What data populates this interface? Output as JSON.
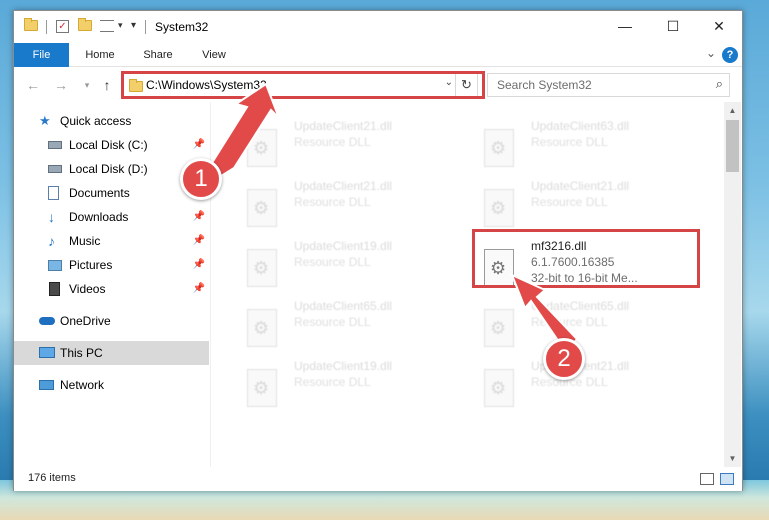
{
  "window": {
    "title": "System32",
    "controls": {
      "minimize": "—",
      "maximize": "☐",
      "close": "✕"
    }
  },
  "ribbon": {
    "tabs": [
      "File",
      "Home",
      "Share",
      "View"
    ],
    "help": "?"
  },
  "nav": {
    "address": "C:\\Windows\\System32",
    "search_placeholder": "Search System32"
  },
  "sidebar": {
    "items": [
      {
        "label": "Quick access",
        "icon": "star-icon"
      },
      {
        "label": "Local Disk (C:)",
        "icon": "drive-icon",
        "pinned": true
      },
      {
        "label": "Local Disk (D:)",
        "icon": "drive-icon"
      },
      {
        "label": "Documents",
        "icon": "documents-icon"
      },
      {
        "label": "Downloads",
        "icon": "downloads-icon",
        "pinned": true
      },
      {
        "label": "Music",
        "icon": "music-icon",
        "pinned": true
      },
      {
        "label": "Pictures",
        "icon": "pictures-icon",
        "pinned": true
      },
      {
        "label": "Videos",
        "icon": "videos-icon",
        "pinned": true
      },
      {
        "label": "OneDrive",
        "icon": "cloud-icon"
      },
      {
        "label": "This PC",
        "icon": "pc-icon",
        "selected": true
      },
      {
        "label": "Network",
        "icon": "network-icon"
      }
    ]
  },
  "files": [
    {
      "name": "UpdateClient21.dll",
      "desc": "Resource DLL"
    },
    {
      "name": "UpdateClient63.dll",
      "desc": "Resource DLL"
    },
    {
      "name": "UpdateClient21.dll",
      "desc": "Resource DLL"
    },
    {
      "name": "UpdateClient21.dll",
      "desc": "Resource DLL"
    },
    {
      "name": "UpdateClient19.dll",
      "desc": "Resource DLL"
    },
    {
      "name": "mf3216.dll",
      "desc": "6.1.7600.16385",
      "desc2": "32-bit to 16-bit Me..."
    },
    {
      "name": "UpdateClient65.dll",
      "desc": "Resource DLL"
    },
    {
      "name": "UpdateClient65.dll",
      "desc": "Resource DLL"
    },
    {
      "name": "UpdateClient19.dll",
      "desc": "Resource DLL"
    },
    {
      "name": "UpdateClient21.dll",
      "desc": "Resource DLL"
    }
  ],
  "status": {
    "items_count": "176 items"
  },
  "callouts": {
    "one": "1",
    "two": "2"
  },
  "colors": {
    "accent": "#1979ca",
    "highlight": "#d64545"
  }
}
